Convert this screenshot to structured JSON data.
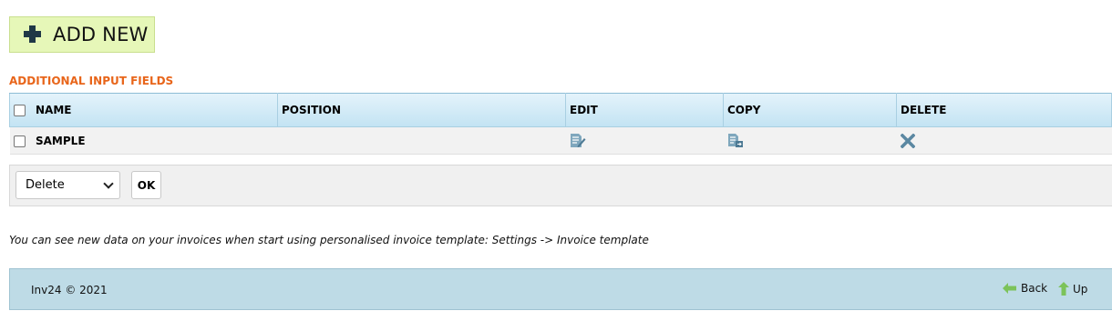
{
  "toolbar": {
    "add_new_label": "ADD NEW"
  },
  "section": {
    "title": "ADDITIONAL INPUT FIELDS"
  },
  "table": {
    "columns": [
      "NAME",
      "POSITION",
      "EDIT",
      "COPY",
      "DELETE"
    ],
    "rows": [
      {
        "name": "SAMPLE",
        "position": ""
      }
    ]
  },
  "bulk_action": {
    "selected": "Delete",
    "ok_label": "OK"
  },
  "info_text": "You can see new data on your invoices when start using personalised invoice template: Settings -> Invoice template",
  "footer": {
    "copyright": "Inv24 © 2021",
    "back_label": "Back",
    "up_label": "Up"
  },
  "colors": {
    "add_button_bg": "#e6f7b8",
    "section_title": "#e8651a",
    "footer_bg": "#bedbe6",
    "icon_blue": "#5b88a2",
    "arrow_green": "#7cc35a"
  },
  "icons": [
    "plus-icon",
    "edit-icon",
    "copy-icon",
    "delete-icon",
    "back-arrow-icon",
    "up-arrow-icon",
    "chevron-down-icon"
  ]
}
